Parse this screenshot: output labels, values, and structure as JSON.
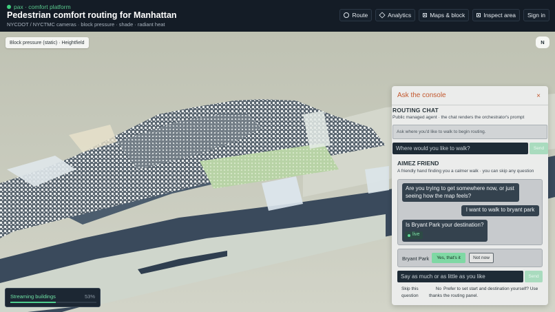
{
  "header": {
    "brand": "pax · comfort platform",
    "title": "Pedestrian comfort routing for Manhattan",
    "subtitle": "NYCDOT / NYCTMC cameras · block pressure · shade · radiant heat",
    "nav": [
      {
        "label": "Route",
        "icon": "circle-icon"
      },
      {
        "label": "Analytics",
        "icon": "diamond-icon"
      },
      {
        "label": "Maps & block",
        "icon": "square-icon"
      },
      {
        "label": "Inspect area",
        "icon": "square-icon"
      },
      {
        "label": "Sign in",
        "icon": ""
      }
    ]
  },
  "map": {
    "layer_label": "Block pressure (static) · Heightfield",
    "compass": "N",
    "streaming": {
      "label": "Streaming buildings",
      "percent_text": "53%",
      "progress": 0.53
    }
  },
  "console": {
    "title": "Ask the console",
    "close": "×",
    "routing": {
      "title": "ROUTING CHAT",
      "subtitle": "Public managed agent · the chat renders the orchestrator's prompt",
      "prompt": "Ask where you'd like to walk to begin routing.",
      "input_placeholder": "Where would you like to walk?",
      "send": "Send"
    },
    "friend": {
      "title": "AIMEZ FRIEND",
      "subtitle": "A friendly hand finding you a calmer walk · you can skip any question",
      "messages": {
        "q1": "Are you trying to get somewhere now, or just seeing how the map feels?",
        "a1": "I want to walk to bryant park",
        "q2": "Is Bryant Park your destination?",
        "live": "live"
      },
      "choice": {
        "label": "Bryant Park",
        "yes": "Yes, that's it",
        "no": "Not now"
      },
      "input_placeholder": "Say as much or as little as you like",
      "send": "Send",
      "footer": {
        "skip": "Skip this question",
        "no_thanks": "No thanks",
        "prefer": "Prefer to set start and destination yourself? Use the routing panel."
      }
    }
  },
  "colors": {
    "accent": "#c2572d",
    "live_green": "#4fd08f",
    "header_bg": "#141c26"
  }
}
